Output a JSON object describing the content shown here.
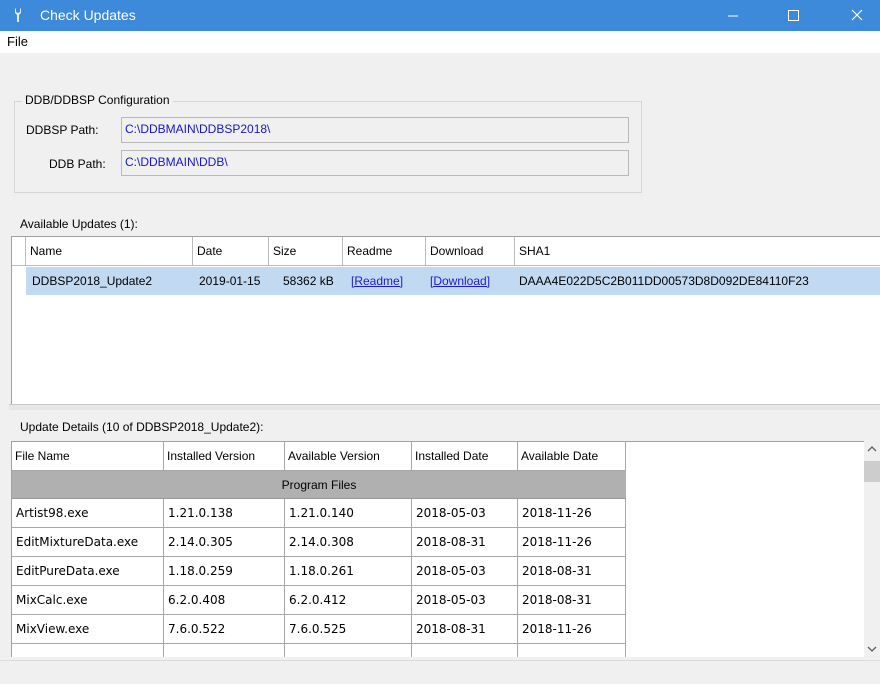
{
  "window": {
    "title": "Check Updates",
    "accent_color": "#3c8ad9",
    "icons": [
      "wrench-icon",
      "minimize-icon",
      "maximize-icon",
      "close-icon"
    ]
  },
  "menu": {
    "file": "File"
  },
  "config": {
    "group_title": "DDB/DDBSP Configuration",
    "ddbsp_label": "DDBSP Path:",
    "ddbsp_value": "C:\\DDBMAIN\\DDBSP2018\\",
    "ddb_label": "DDB Path:",
    "ddb_value": "C:\\DDBMAIN\\DDB\\"
  },
  "updates": {
    "label": "Available Updates (1):",
    "columns": [
      "Name",
      "Date",
      "Size",
      "Readme",
      "Download",
      "SHA1"
    ],
    "rows": [
      {
        "name": "DDBSP2018_Update2",
        "date": "2019-01-15",
        "size": "58362 kB",
        "readme": "[Readme]",
        "download": "[Download]",
        "sha1": "DAAA4E022D5C2B011DD00573D8D092DE84110F23"
      }
    ],
    "selected_color": "#c2d9f2"
  },
  "details": {
    "label": "Update Details (10 of DDBSP2018_Update2):",
    "columns": [
      "File Name",
      "Installed Version",
      "Available Version",
      "Installed Date",
      "Available Date"
    ],
    "group": "Program Files",
    "rows": [
      [
        "Artist98.exe",
        "1.21.0.138",
        "1.21.0.140",
        "2018-05-03",
        "2018-11-26"
      ],
      [
        "EditMixtureData.exe",
        "2.14.0.305",
        "2.14.0.308",
        "2018-08-31",
        "2018-11-26"
      ],
      [
        "EditPureData.exe",
        "1.18.0.259",
        "1.18.0.261",
        "2018-05-03",
        "2018-08-31"
      ],
      [
        "MixCalc.exe",
        "6.2.0.408",
        "6.2.0.412",
        "2018-05-03",
        "2018-08-31"
      ],
      [
        "MixView.exe",
        "7.6.0.522",
        "7.6.0.525",
        "2018-08-31",
        "2018-11-26"
      ]
    ]
  }
}
